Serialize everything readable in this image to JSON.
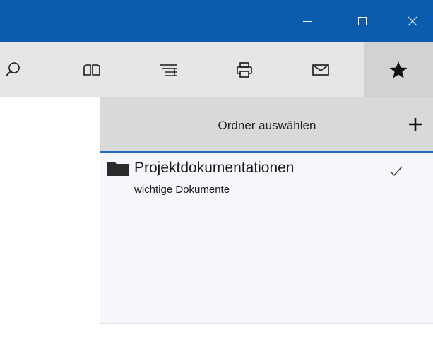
{
  "window": {
    "minimize_glyph": "minimize-icon",
    "maximize_glyph": "maximize-icon",
    "close_glyph": "close-icon"
  },
  "toolbar": {
    "buttons": [
      {
        "name": "search-icon"
      },
      {
        "name": "reading-view-icon"
      },
      {
        "name": "list-icon"
      },
      {
        "name": "print-icon"
      },
      {
        "name": "mail-icon"
      },
      {
        "name": "favorites-star-icon",
        "active": true
      }
    ]
  },
  "panel": {
    "title": "Ordner auswählen",
    "add_icon": "plus-icon",
    "folders": [
      {
        "name": "Projektdokumentationen",
        "description": "wichtige Dokumente",
        "selected": true
      }
    ]
  },
  "colors": {
    "titlebar": "#0b5cad",
    "toolbar": "#e6e6e6",
    "active_tab": "#d2d2d2",
    "panel_header": "#d9d9d9",
    "panel_body": "#f5f7fc",
    "accent_line": "#1f6cc2"
  }
}
